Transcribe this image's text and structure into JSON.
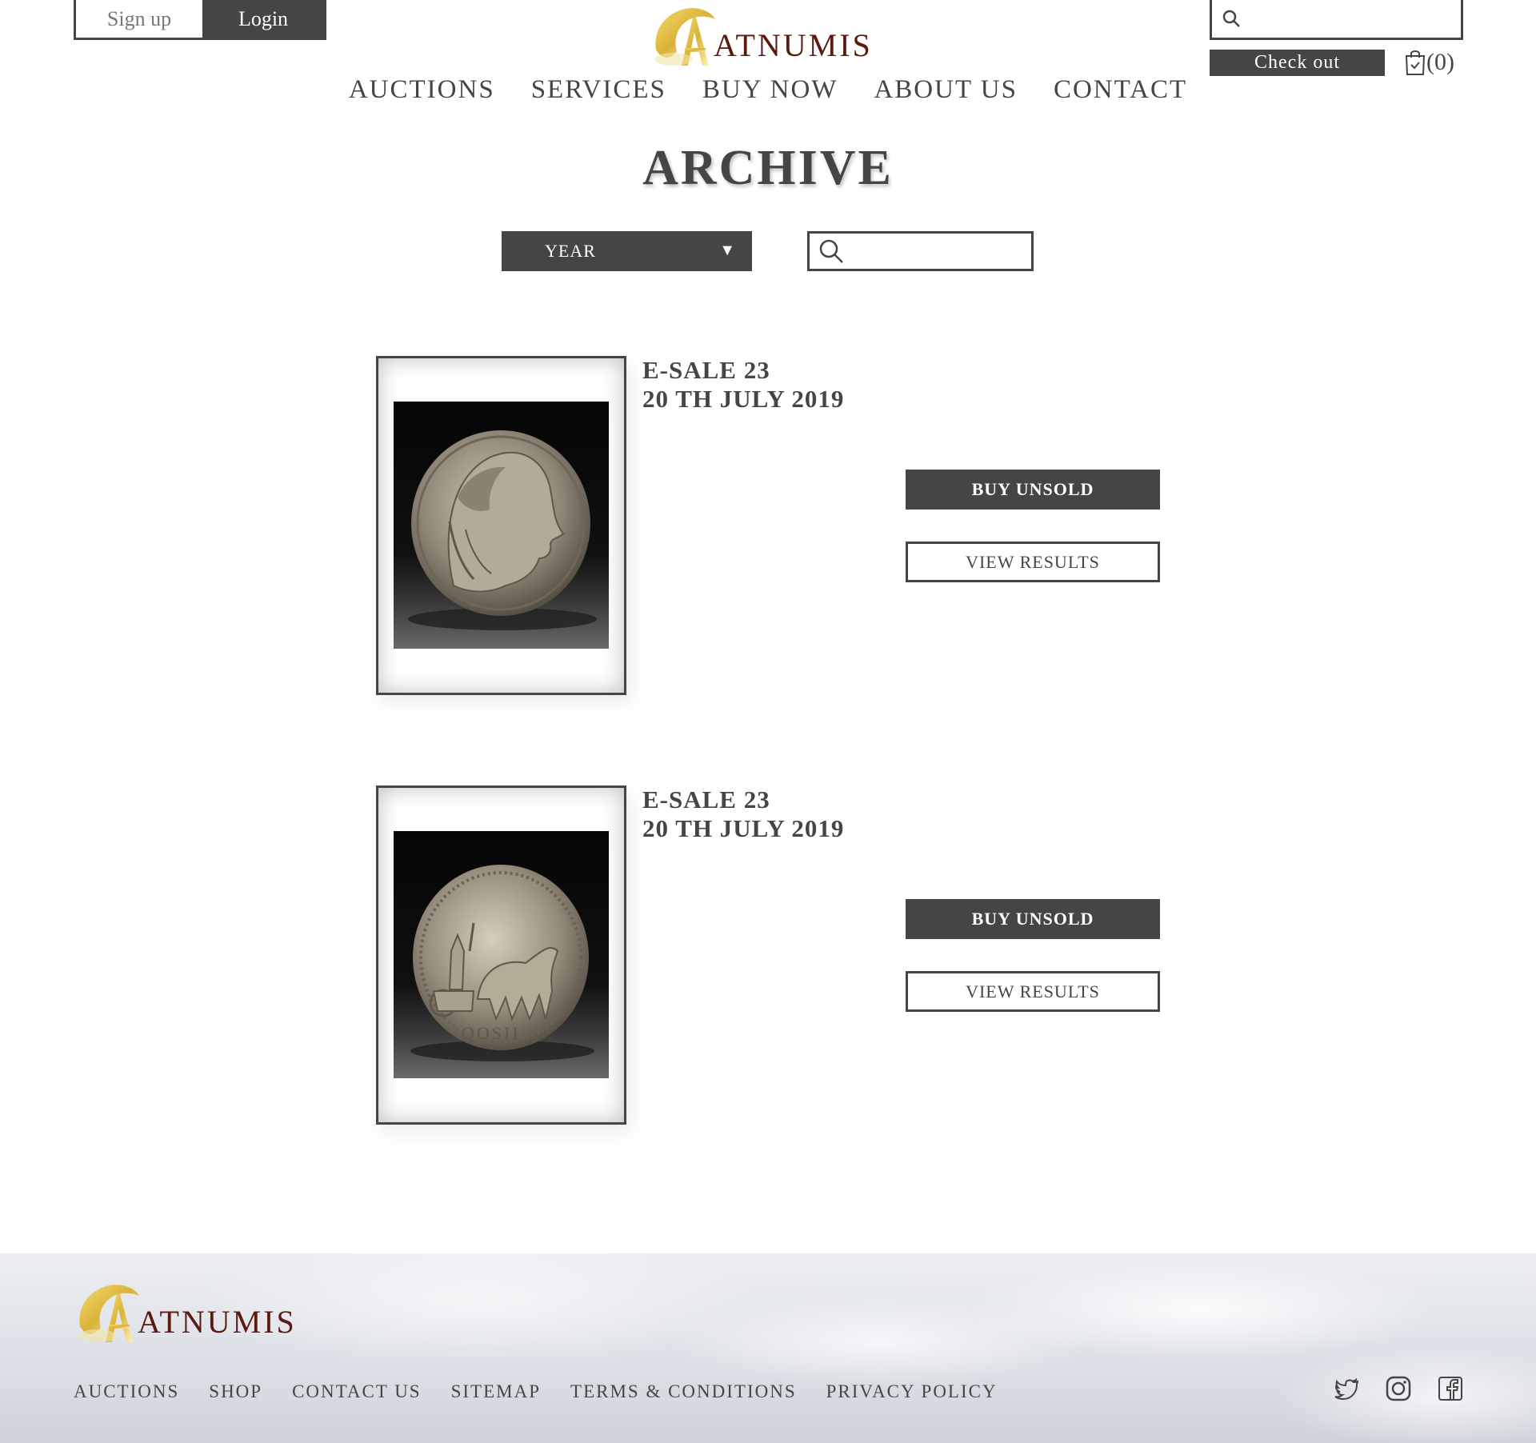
{
  "auth": {
    "signup_label": "Sign up",
    "login_label": "Login"
  },
  "brand": {
    "name": "ATNUMIS",
    "text_color": "#5a1a10",
    "gold": "#d9b23a"
  },
  "header": {
    "checkout_label": "Check out",
    "cart_count": "(0)"
  },
  "nav": {
    "items": [
      "AUCTIONS",
      "SERVICES",
      "BUY NOW",
      "ABOUT US",
      "CONTACT"
    ]
  },
  "page": {
    "title": "ARCHIVE"
  },
  "filters": {
    "year_label": "YEAR"
  },
  "sales": [
    {
      "name": "E-SALE 23",
      "date": "20 TH JULY 2019",
      "buy_label": "BUY UNSOLD",
      "view_label": "VIEW RESULTS",
      "coin_icon": "coin-head-icon"
    },
    {
      "name": "E-SALE 23",
      "date": "20 TH JULY 2019",
      "buy_label": "BUY UNSOLD",
      "view_label": "VIEW RESULTS",
      "coin_icon": "coin-chariot-icon"
    }
  ],
  "footer": {
    "links": [
      "AUCTIONS",
      "SHOP",
      "CONTACT US",
      "SITEMAP",
      "TERMS & CONDITIONS",
      "PRIVACY POLICY"
    ]
  },
  "colors": {
    "primary": "#454545",
    "background": "#ffffff"
  }
}
